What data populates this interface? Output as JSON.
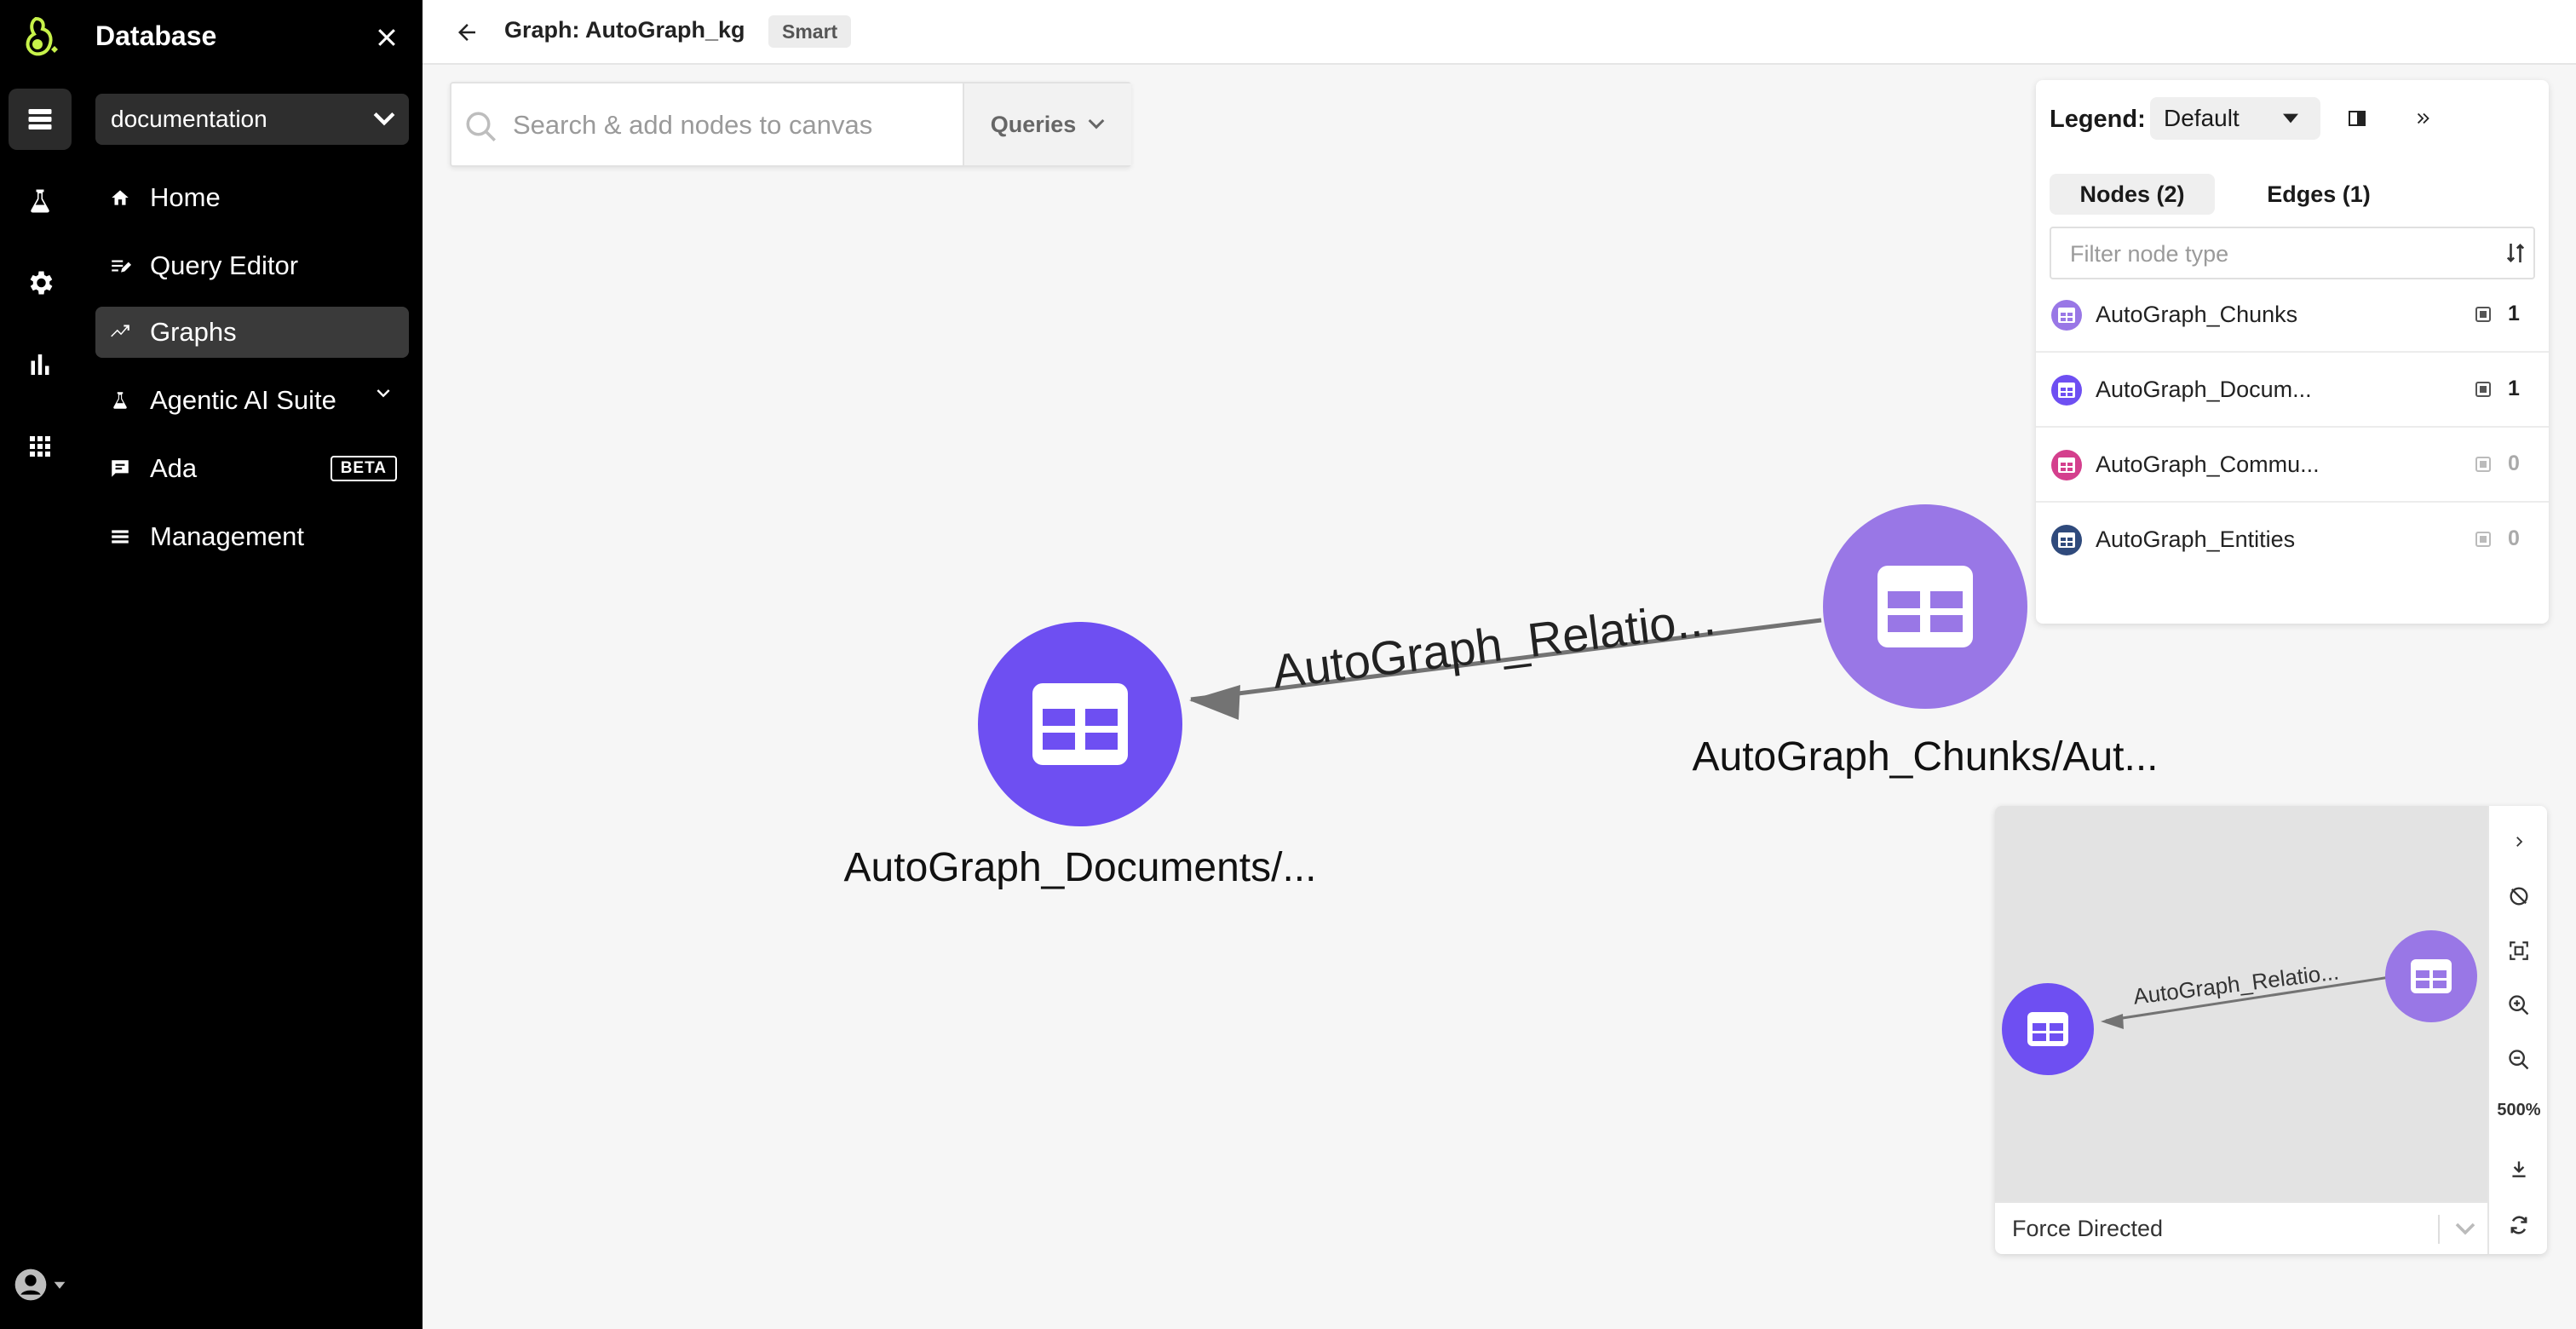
{
  "rail": {
    "icons": [
      "logo",
      "database-icon",
      "flask-icon",
      "gear-icon",
      "bar-chart-icon",
      "apps-grid-icon",
      "user-avatar-icon"
    ]
  },
  "sidebar": {
    "title": "Database",
    "database_select": "documentation",
    "items": [
      {
        "label": "Home",
        "icon": "home-icon"
      },
      {
        "label": "Query Editor",
        "icon": "query-editor-icon"
      },
      {
        "label": "Graphs",
        "icon": "graphs-icon",
        "active": true
      },
      {
        "label": "Agentic AI Suite",
        "icon": "flask-icon"
      },
      {
        "label": "Ada",
        "icon": "chat-icon",
        "badge": "BETA"
      },
      {
        "label": "Management",
        "icon": "list-icon"
      }
    ]
  },
  "header": {
    "title": "Graph: AutoGraph_kg",
    "badge": "Smart"
  },
  "search": {
    "placeholder": "Search & add nodes to canvas",
    "queries_label": "Queries"
  },
  "graph": {
    "nodes": [
      {
        "label": "AutoGraph_Documents/...",
        "color": "#6e4ff2"
      },
      {
        "label": "AutoGraph_Chunks/Aut...",
        "color": "#9977e6"
      }
    ],
    "edge_label": "AutoGraph_Relatio..."
  },
  "legend": {
    "label": "Legend:",
    "selected": "Default",
    "tabs": {
      "nodes": "Nodes (2)",
      "edges": "Edges (1)"
    },
    "filter_placeholder": "Filter node type",
    "types": [
      {
        "name": "AutoGraph_Chunks",
        "count": "1",
        "color": "#9977e6"
      },
      {
        "name": "AutoGraph_Docum...",
        "count": "1",
        "color": "#6e4ff2"
      },
      {
        "name": "AutoGraph_Commu...",
        "count": "0",
        "color": "#d43f8d"
      },
      {
        "name": "AutoGraph_Entities",
        "count": "0",
        "color": "#2f4a7c"
      }
    ]
  },
  "minimap": {
    "edge_label": "AutoGraph_Relatio...",
    "zoom": "500%",
    "layout": "Force Directed"
  }
}
